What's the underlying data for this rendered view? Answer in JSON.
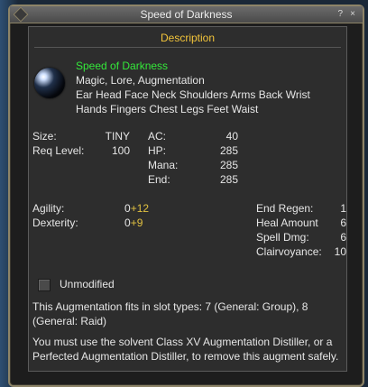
{
  "window": {
    "title": "Speed of Darkness",
    "help": "?",
    "close": "×"
  },
  "section": {
    "heading": "Description"
  },
  "item": {
    "name": "Speed of Darkness",
    "tags": "Magic, Lore, Augmentation",
    "slots_line1": "Ear Head Face Neck Shoulders Arms Back Wrist",
    "slots_line2": "Hands Fingers Chest Legs Feet Waist"
  },
  "stats": {
    "size_label": "Size:",
    "size_value": "TINY",
    "req_label": "Req Level:",
    "req_value": "100",
    "ac_label": "AC:",
    "ac_value": "40",
    "hp_label": "HP:",
    "hp_value": "285",
    "mana_label": "Mana:",
    "mana_value": "285",
    "end_label": "End:",
    "end_value": "285"
  },
  "attributes": {
    "agility_label": "Agility:",
    "agility_base": "0",
    "agility_bonus": "+12",
    "dexterity_label": "Dexterity:",
    "dexterity_base": "0",
    "dexterity_bonus": "+9"
  },
  "mods": {
    "endregen_label": "End Regen:",
    "endregen_value": "1",
    "heal_label": "Heal Amount",
    "heal_value": "6",
    "spell_label": "Spell Dmg:",
    "spell_value": "6",
    "clair_label": "Clairvoyance:",
    "clair_value": "10"
  },
  "unmodified": {
    "label": "Unmodified",
    "checked": false
  },
  "notes": {
    "fits_line1": "This Augmentation fits in slot types: 7 (General: Group), 8",
    "fits_line2": "(General: Raid)",
    "solvent_line1": "You must use the solvent Class XV Augmentation Distiller, or a",
    "solvent_line2": "Perfected Augmentation Distiller, to remove this augment safely."
  }
}
